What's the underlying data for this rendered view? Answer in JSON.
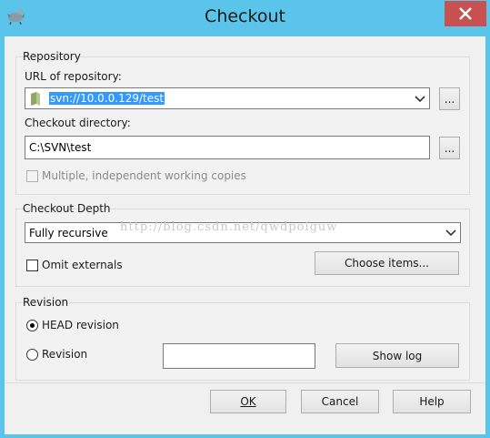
{
  "window": {
    "title": "Checkout"
  },
  "repository": {
    "group_title": "Repository",
    "url_label": "URL of repository:",
    "url_value": "svn://10.0.0.129/test",
    "browse_label": "...",
    "dir_label": "Checkout directory:",
    "dir_value": "C:\\SVN\\test",
    "dir_browse_label": "...",
    "multiple_label": "Multiple, independent working copies"
  },
  "depth": {
    "group_title": "Checkout Depth",
    "selected": "Fully recursive",
    "omit_label": "Omit externals",
    "choose_label": "Choose items..."
  },
  "revision": {
    "group_title": "Revision",
    "head_label": "HEAD revision",
    "revision_label": "Revision",
    "revision_value": "",
    "show_log_label": "Show log"
  },
  "buttons": {
    "ok": "OK",
    "cancel": "Cancel",
    "help": "Help"
  },
  "watermark": "http://blog.csdn.net/qwdpoiguw",
  "colors": {
    "titlebar": "#5bc4ea",
    "close": "#c75050",
    "selection": "#3399ff"
  }
}
